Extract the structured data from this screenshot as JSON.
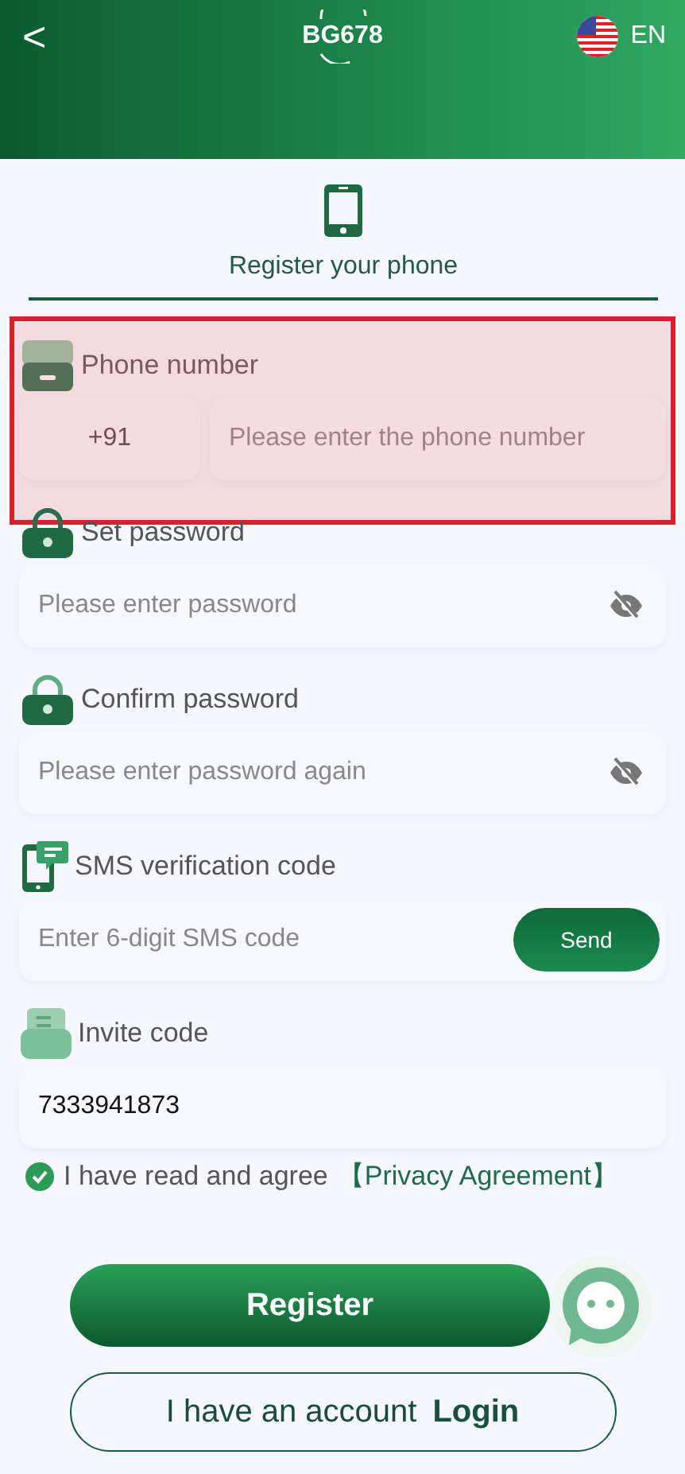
{
  "header": {
    "back": "<",
    "logo": "BG678",
    "language": "EN"
  },
  "tab": {
    "label": "Register your phone",
    "selected": true
  },
  "fields": [
    {
      "kind": "phone",
      "label": "Phone number",
      "country_code": "+91",
      "placeholder": "Please enter the phone number",
      "highlighted": true
    },
    {
      "kind": "password",
      "label": "Set password",
      "placeholder": "Please enter password",
      "highlighted": false
    },
    {
      "kind": "confirm",
      "label": "Confirm password",
      "placeholder": "Please enter password again",
      "highlighted": false
    },
    {
      "kind": "sms",
      "label": "SMS verification code",
      "placeholder": "Enter 6-digit SMS code",
      "button": "Send",
      "highlighted": false
    },
    {
      "kind": "invite",
      "label": "Invite code",
      "value": "7333941873",
      "highlighted": false
    }
  ],
  "agreement": {
    "checked": true,
    "text": "I have read and agree",
    "link": "【Privacy Agreement】"
  },
  "register_button": "Register",
  "login": {
    "text": "I have an account",
    "link": "Login"
  }
}
